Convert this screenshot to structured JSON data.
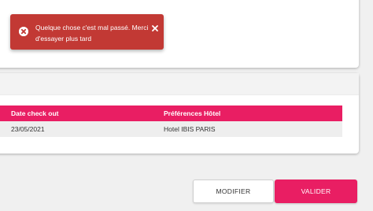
{
  "toast": {
    "message": "Quelque chose c'est mal passé. Merci d'essayer plus tard",
    "icon": "error-circle-icon",
    "close_icon": "close-icon",
    "color": "#c23934"
  },
  "table": {
    "headers": [
      "Date check out",
      "Préférences Hôtel"
    ],
    "rows": [
      [
        "23/05/2021",
        "Hotel IBIS PARIS"
      ]
    ]
  },
  "buttons": {
    "modify_label": "MODIFIER",
    "validate_label": "VALIDER"
  },
  "colors": {
    "accent": "#e91e63",
    "error": "#c23934"
  }
}
